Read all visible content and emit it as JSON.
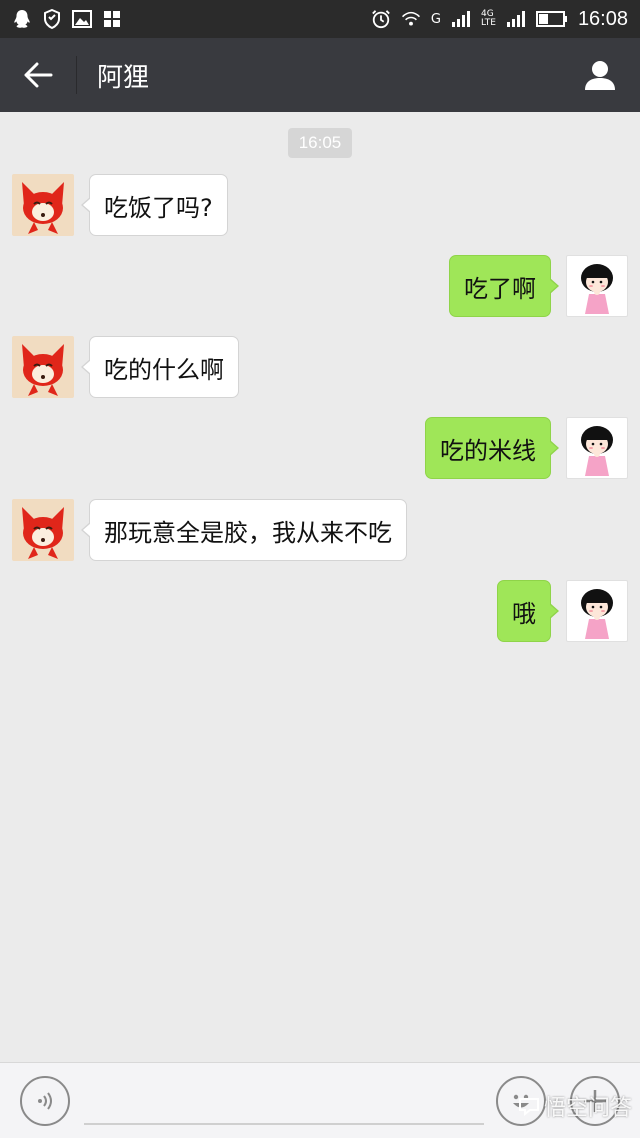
{
  "status_bar": {
    "icons_left": [
      "qq-icon",
      "shield-icon",
      "image-icon",
      "apps-icon"
    ],
    "network_g": "G",
    "network_4g": "4G",
    "network_lte": "LTE",
    "time": "16:08"
  },
  "header": {
    "title": "阿狸"
  },
  "chat": {
    "timestamp": "16:05",
    "messages": [
      {
        "side": "left",
        "text": "吃饭了吗?"
      },
      {
        "side": "right",
        "text": "吃了啊"
      },
      {
        "side": "left",
        "text": "吃的什么啊"
      },
      {
        "side": "right",
        "text": "吃的米线"
      },
      {
        "side": "left",
        "text": "那玩意全是胶，我从来不吃"
      },
      {
        "side": "right",
        "text": "哦"
      }
    ]
  },
  "input_bar": {
    "placeholder": ""
  },
  "watermark": {
    "text": "悟空问答"
  },
  "colors": {
    "statusbar": "#2b2b2b",
    "titlebar": "#393a3f",
    "background": "#ebebeb",
    "bubble_sent": "#9fe658",
    "bubble_received": "#ffffff"
  }
}
